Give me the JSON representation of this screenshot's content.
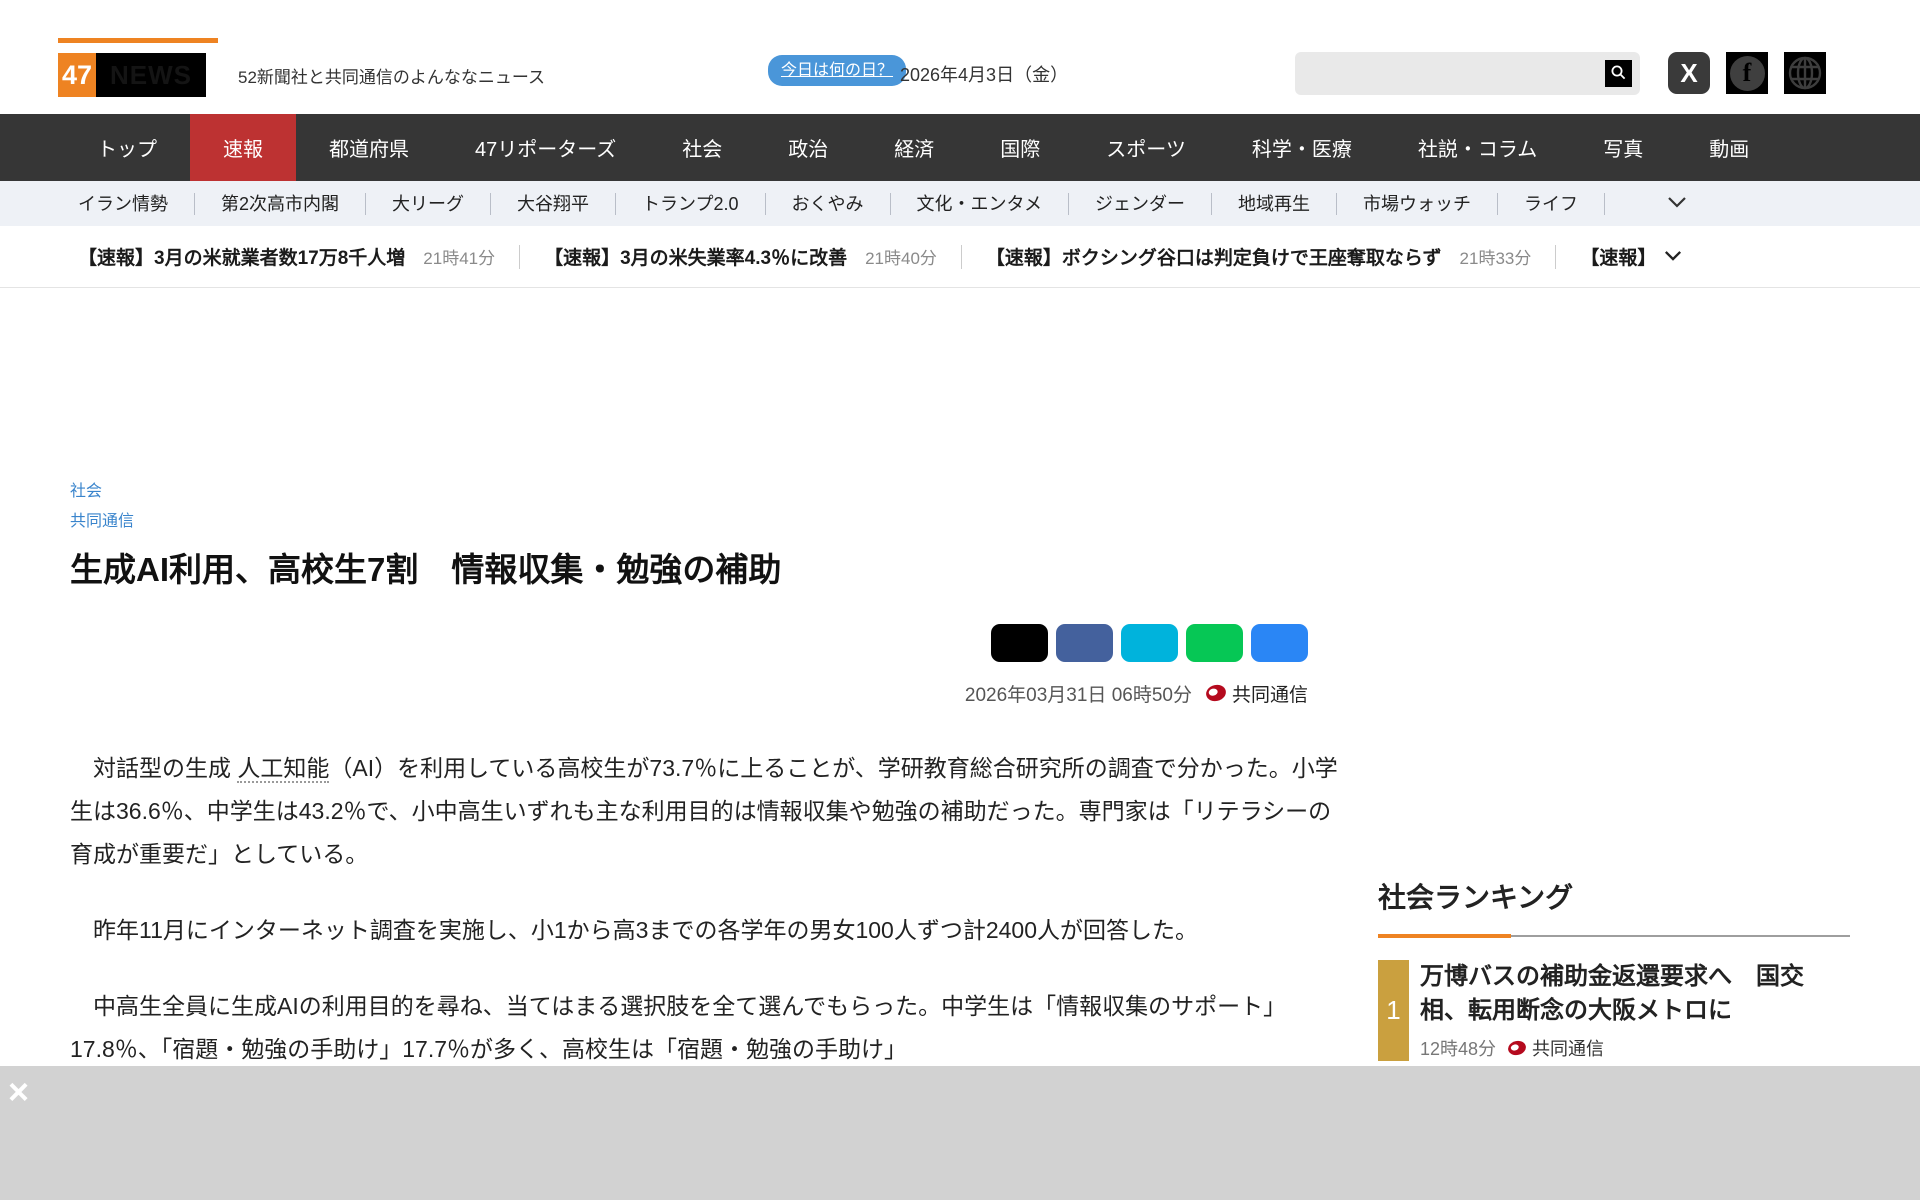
{
  "header": {
    "logo": {
      "num": "47",
      "news": "NEWS"
    },
    "tagline": "52新聞社と共同通信のよんななニュース",
    "today_button": "今日は何の日？",
    "date": "2026年4月3日（金）",
    "search_placeholder": ""
  },
  "nav": {
    "items": [
      {
        "label": "トップ"
      },
      {
        "label": "速報"
      },
      {
        "label": "都道府県"
      },
      {
        "label": "47リポーターズ"
      },
      {
        "label": "社会"
      },
      {
        "label": "政治"
      },
      {
        "label": "経済"
      },
      {
        "label": "国際"
      },
      {
        "label": "スポーツ"
      },
      {
        "label": "科学・医療"
      },
      {
        "label": "社説・コラム"
      },
      {
        "label": "写真"
      },
      {
        "label": "動画"
      }
    ]
  },
  "subnav": {
    "items": [
      {
        "label": "イラン情勢"
      },
      {
        "label": "第2次高市内閣"
      },
      {
        "label": "大リーグ"
      },
      {
        "label": "大谷翔平"
      },
      {
        "label": "トランプ2.0"
      },
      {
        "label": "おくやみ"
      },
      {
        "label": "文化・エンタメ"
      },
      {
        "label": "ジェンダー"
      },
      {
        "label": "地域再生"
      },
      {
        "label": "市場ウォッチ"
      },
      {
        "label": "ライフ"
      }
    ]
  },
  "ticker": {
    "items": [
      {
        "title": "【速報】3月の米就業者数17万8千人増",
        "time": "21時41分"
      },
      {
        "title": "【速報】3月の米失業率4.3％に改善",
        "time": "21時40分"
      },
      {
        "title": "【速報】ボクシング谷口は判定負けで王座奪取ならず",
        "time": "21時33分"
      }
    ],
    "more_label": "【速報】"
  },
  "article": {
    "category": "社会",
    "source_link": "共同通信",
    "title": "生成AI利用、高校生7割　情報収集・勉強の補助",
    "published": "2026年03月31日 06時50分",
    "source": "共同通信",
    "share_colors": {
      "c1": "#000000",
      "c2": "#44619d",
      "c3": "#00b3dc",
      "c4": "#06c755",
      "c5": "#2a86f5"
    },
    "body": {
      "p1_pre": "　対話型の生成 ",
      "p1_keyword": "人工知能",
      "p1_post": "（AI）を利用している高校生が73.7％に上ることが、学研教育総合研究所の調査で分かった。小学生は36.6％、中学生は43.2％で、小中高生いずれも主な利用目的は情報収集や勉強の補助だった。専門家は「リテラシーの育成が重要だ」としている。",
      "p2": "　昨年11月にインターネット調査を実施し、小1から高3までの各学年の男女100人ずつ計2400人が回答した。",
      "p3": "　中高生全員に生成AIの利用目的を尋ね、当てはまる選択肢を全て選んでもらった。中学生は「情報収集のサポート」17.8％、「宿題・勉強の手助け」17.7％が多く、高校生は「宿題・勉強の手助け」"
    }
  },
  "ranking": {
    "title": "社会ランキング",
    "items": [
      {
        "rank": "1",
        "title": "万博バスの補助金返還要求へ　国交相、転用断念の大阪メトロに",
        "time": "12時48分",
        "source": "共同通信"
      }
    ]
  },
  "adbar": {
    "close": "×"
  },
  "colors": {
    "brand_orange": "#ee8322",
    "nav_dark": "#363636",
    "active_red": "#bd3232",
    "rank_gold": "#caa03f",
    "kyodo_red": "#b50a1e",
    "link_blue": "#3984cc"
  }
}
